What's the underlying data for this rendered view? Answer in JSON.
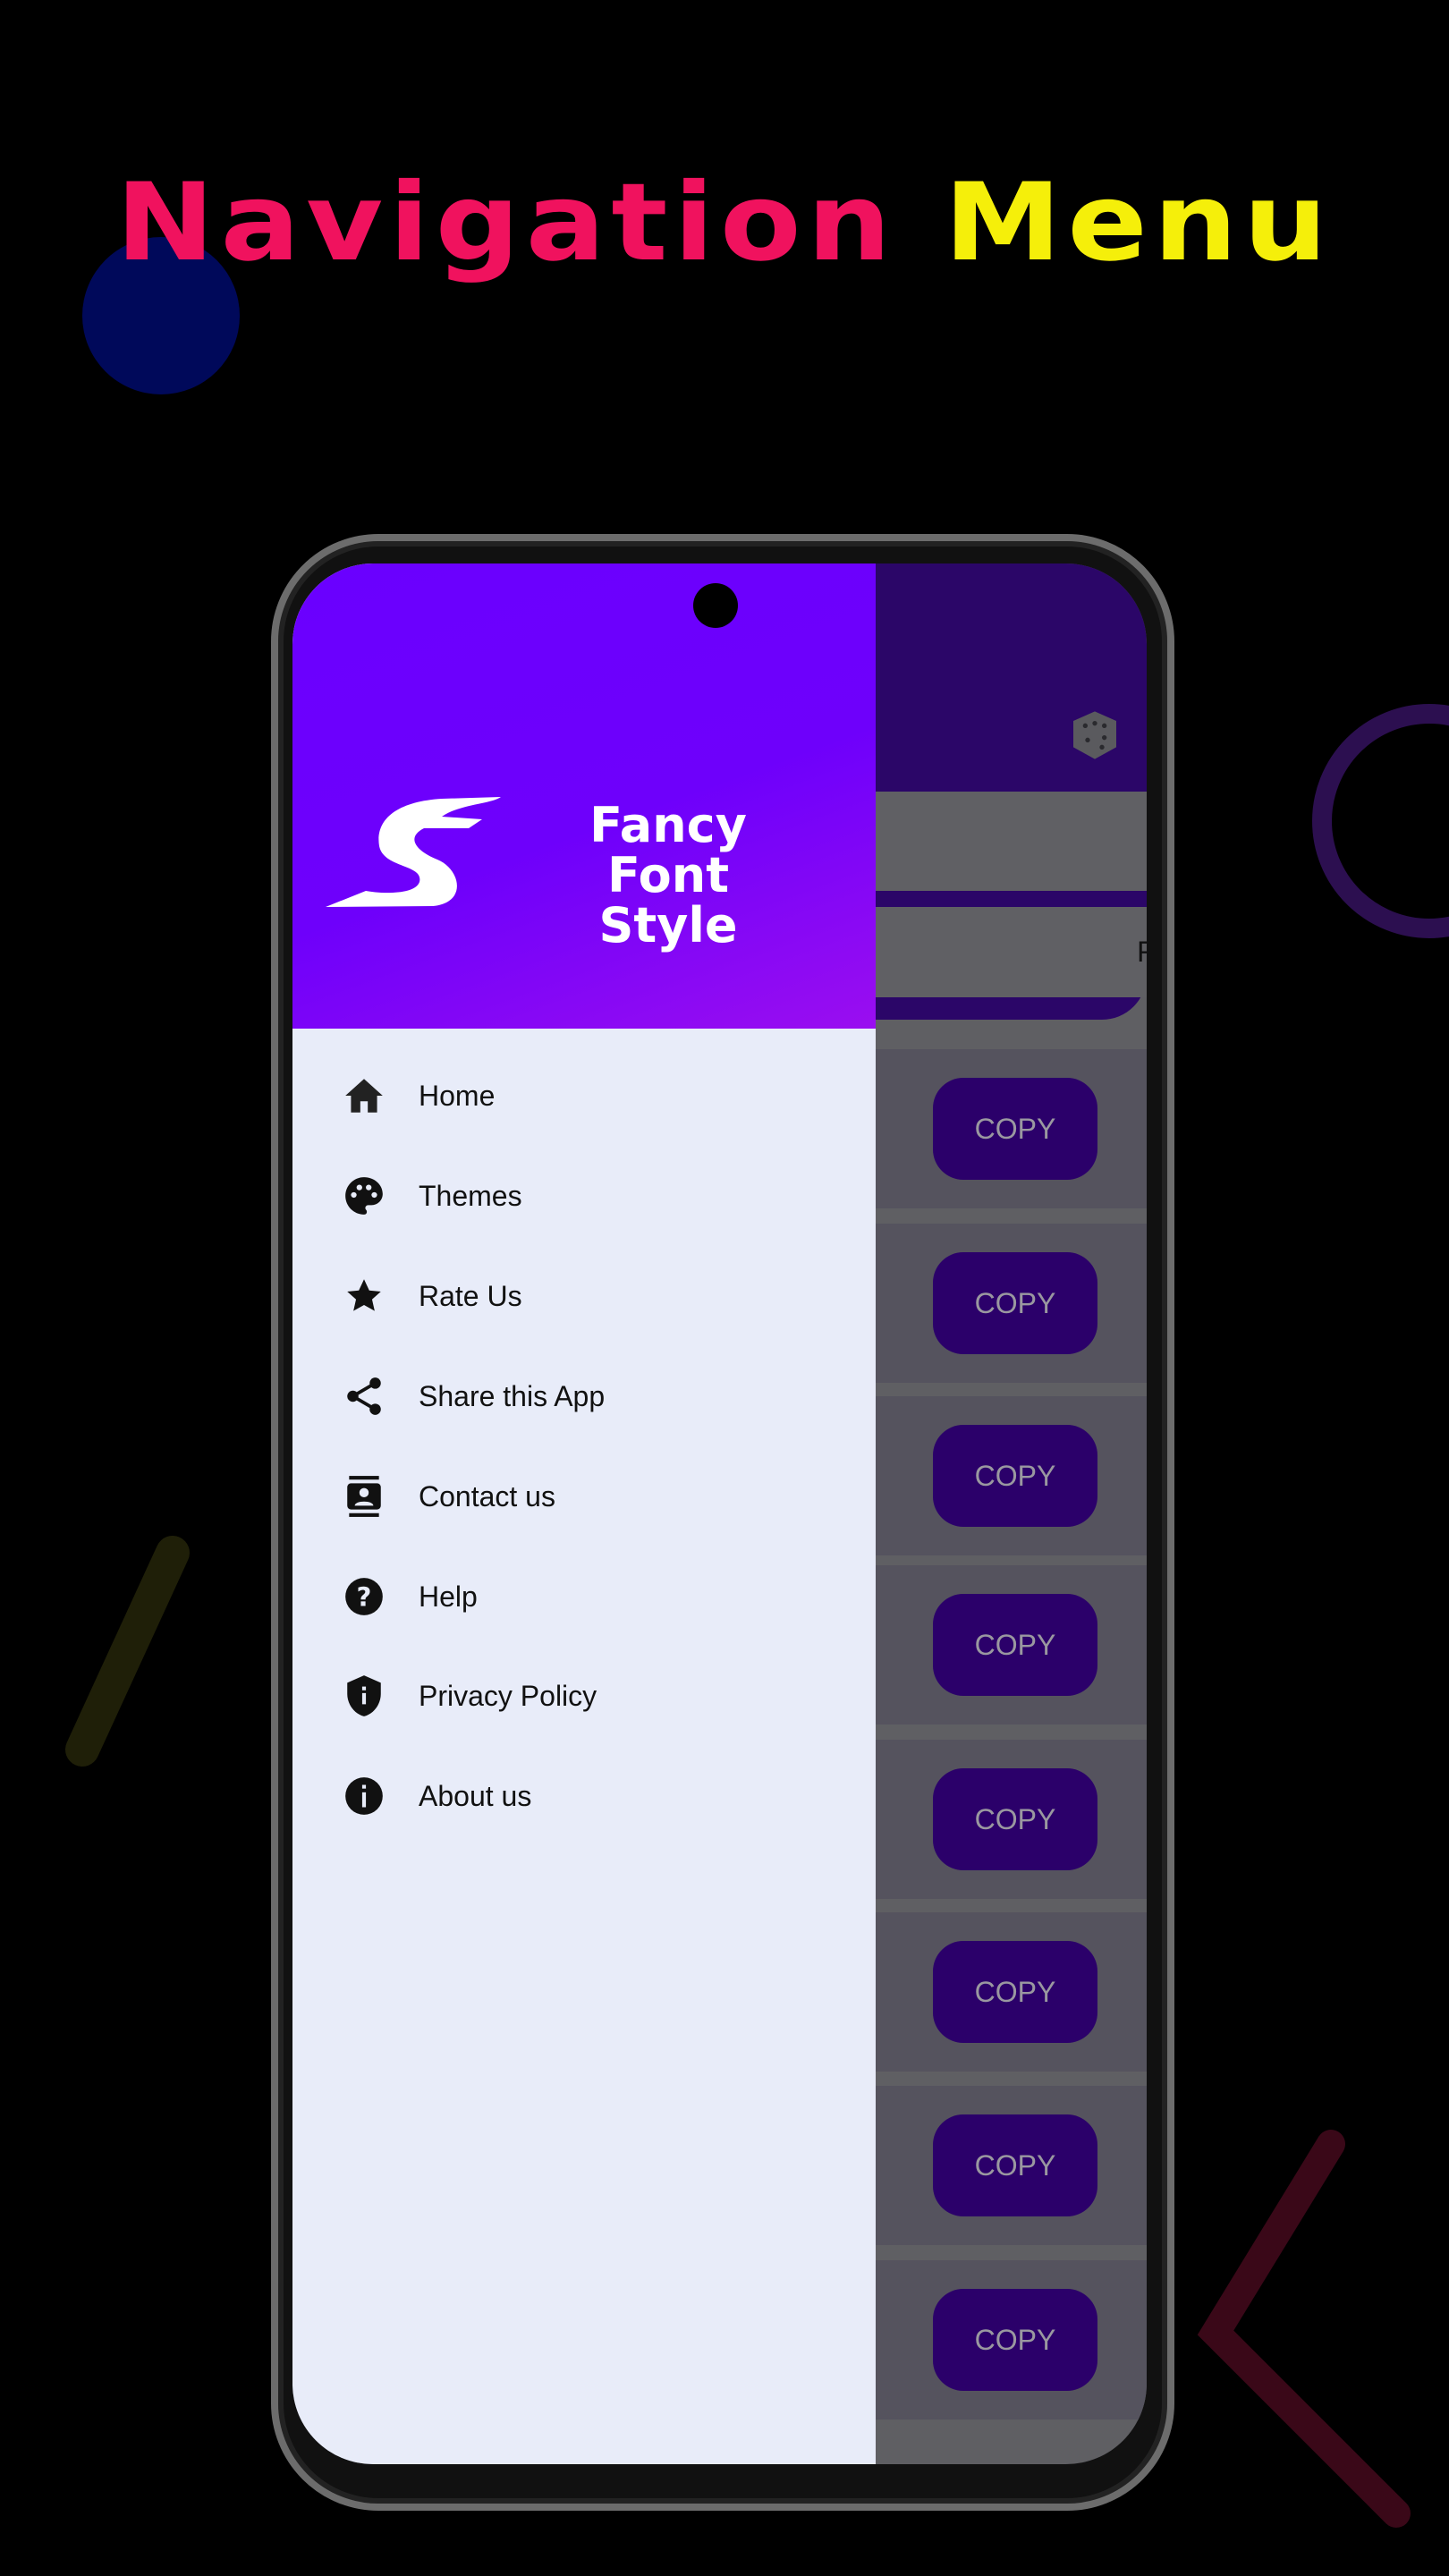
{
  "promo": {
    "title_part1": "Navigation",
    "title_part2": "Menu",
    "title_colors": [
      "#f0125e",
      "#f5ef0a"
    ]
  },
  "app": {
    "brand_line1": "Fancy Font",
    "brand_line2": "Style",
    "alignment_option": "Right",
    "copy_buttons": [
      "COPY",
      "COPY",
      "COPY",
      "COPY",
      "COPY",
      "COPY",
      "COPY",
      "COPY"
    ],
    "accent": "#6a00ff"
  },
  "drawer": {
    "items": [
      {
        "label": "Home",
        "icon": "home-icon"
      },
      {
        "label": "Themes",
        "icon": "palette-icon"
      },
      {
        "label": "Rate Us",
        "icon": "star-icon"
      },
      {
        "label": "Share this App",
        "icon": "share-icon"
      },
      {
        "label": "Contact us",
        "icon": "contact-icon"
      },
      {
        "label": "Help",
        "icon": "help-icon"
      },
      {
        "label": "Privacy Policy",
        "icon": "shield-icon"
      },
      {
        "label": "About us",
        "icon": "info-icon"
      }
    ]
  }
}
